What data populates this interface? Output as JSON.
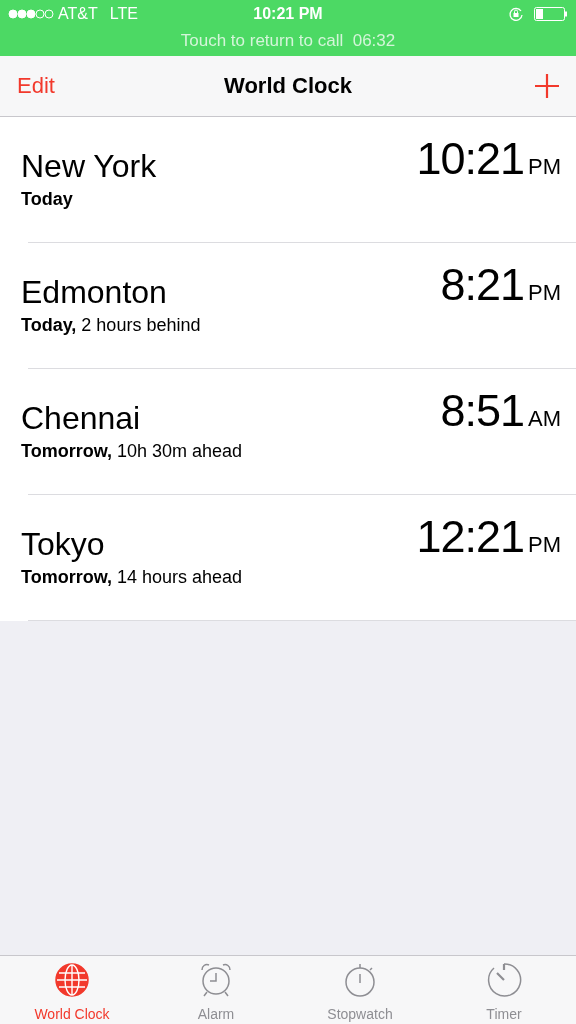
{
  "status_bar": {
    "carrier": "AT&T",
    "network": "LTE",
    "time": "10:21 PM"
  },
  "call_banner": {
    "text": "Touch to return to call",
    "duration": "06:32"
  },
  "nav": {
    "left": "Edit",
    "title": "World Clock"
  },
  "clocks": [
    {
      "city": "New York",
      "day": "Today",
      "time": "10:21",
      "period": "PM"
    },
    {
      "city": "Edmonton",
      "day": "Today,",
      "detail": "2 hours behind",
      "time": "8:21",
      "period": "PM"
    },
    {
      "city": "Chennai",
      "day": "Tomorrow,",
      "detail": "10h 30m ahead",
      "time": "8:51",
      "period": "AM"
    },
    {
      "city": "Tokyo",
      "day": "Tomorrow,",
      "detail": "14 hours ahead",
      "time": "12:21",
      "period": "PM"
    }
  ],
  "tabs": [
    {
      "kind": "globe",
      "label": "World Clock",
      "selected": true
    },
    {
      "kind": "alarm",
      "label": "Alarm",
      "selected": false
    },
    {
      "kind": "stopwatch",
      "label": "Stopwatch",
      "selected": false
    },
    {
      "kind": "timer",
      "label": "Timer",
      "selected": false
    }
  ]
}
